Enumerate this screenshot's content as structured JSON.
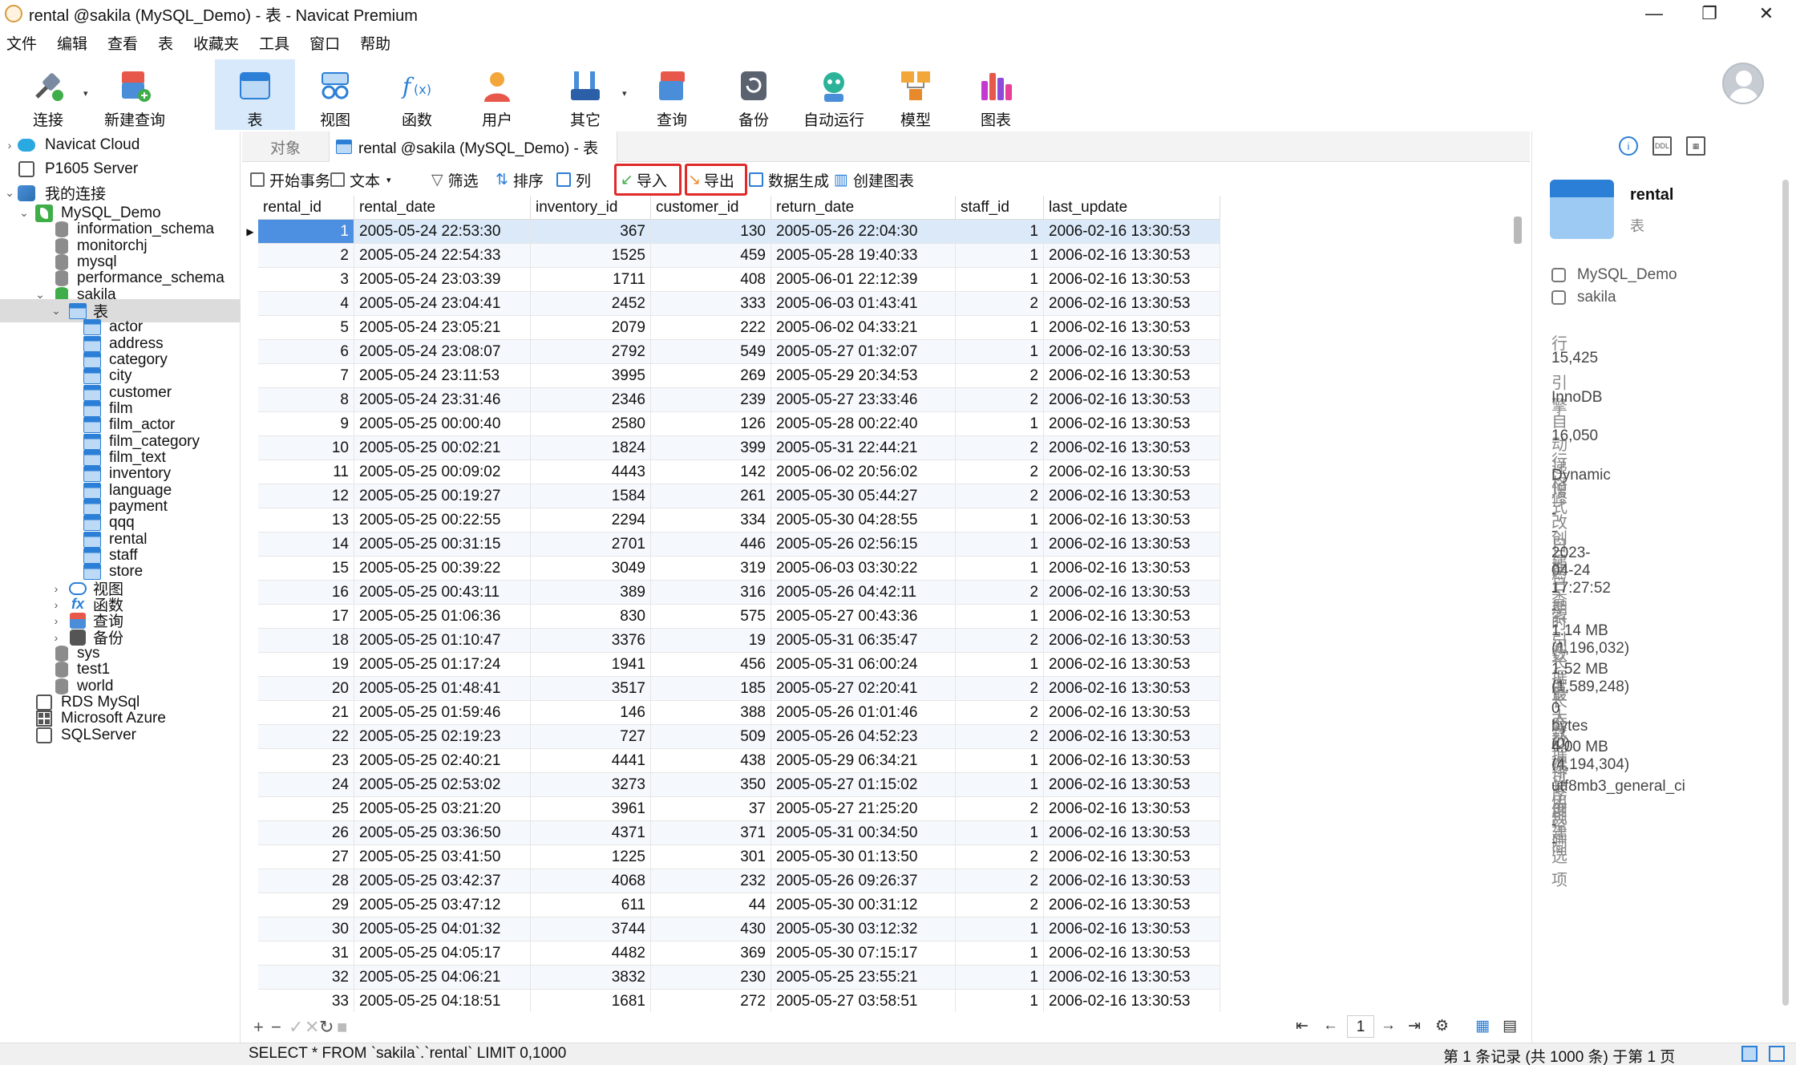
{
  "window": {
    "title": "rental @sakila (MySQL_Demo) - 表 - Navicat Premium"
  },
  "menu": [
    "文件",
    "编辑",
    "查看",
    "表",
    "收藏夹",
    "工具",
    "窗口",
    "帮助"
  ],
  "toolbar": [
    {
      "label": "连接",
      "icon": "plug-connect-icon"
    },
    {
      "label": "新建查询",
      "icon": "new-query-icon"
    },
    {
      "label": "表",
      "icon": "table-icon"
    },
    {
      "label": "视图",
      "icon": "view-glasses-icon"
    },
    {
      "label": "函数",
      "icon": "function-fx-icon"
    },
    {
      "label": "用户",
      "icon": "user-icon"
    },
    {
      "label": "其它",
      "icon": "tools-icon"
    },
    {
      "label": "查询",
      "icon": "query-icon"
    },
    {
      "label": "备份",
      "icon": "backup-icon"
    },
    {
      "label": "自动运行",
      "icon": "robot-icon"
    },
    {
      "label": "模型",
      "icon": "model-icon"
    },
    {
      "label": "图表",
      "icon": "chart-icon"
    }
  ],
  "sidebar": {
    "nodes": [
      {
        "label": "Navicat Cloud",
        "icon": "cloud-icon"
      },
      {
        "label": "P1605 Server",
        "icon": "server-icon"
      },
      {
        "label": "我的连接",
        "icon": "plug-icon"
      },
      {
        "label": "MySQL_Demo",
        "icon": "mysql-connection-icon"
      },
      {
        "label": "information_schema",
        "icon": "database-icon"
      },
      {
        "label": "monitorchj",
        "icon": "database-icon"
      },
      {
        "label": "mysql",
        "icon": "database-icon"
      },
      {
        "label": "performance_schema",
        "icon": "database-icon"
      },
      {
        "label": "sakila",
        "icon": "database-icon"
      },
      {
        "label": "表",
        "icon": "tables-folder-icon"
      },
      {
        "label": "actor",
        "icon": "table-icon"
      },
      {
        "label": "address",
        "icon": "table-icon"
      },
      {
        "label": "category",
        "icon": "table-icon"
      },
      {
        "label": "city",
        "icon": "table-icon"
      },
      {
        "label": "customer",
        "icon": "table-icon"
      },
      {
        "label": "film",
        "icon": "table-icon"
      },
      {
        "label": "film_actor",
        "icon": "table-icon"
      },
      {
        "label": "film_category",
        "icon": "table-icon"
      },
      {
        "label": "film_text",
        "icon": "table-icon"
      },
      {
        "label": "inventory",
        "icon": "table-icon"
      },
      {
        "label": "language",
        "icon": "table-icon"
      },
      {
        "label": "payment",
        "icon": "table-icon"
      },
      {
        "label": "qqq",
        "icon": "table-icon"
      },
      {
        "label": "rental",
        "icon": "table-icon"
      },
      {
        "label": "staff",
        "icon": "table-icon"
      },
      {
        "label": "store",
        "icon": "table-icon"
      },
      {
        "label": "视图",
        "icon": "view-icon"
      },
      {
        "label": "函数",
        "icon": "function-icon"
      },
      {
        "label": "查询",
        "icon": "query-icon"
      },
      {
        "label": "备份",
        "icon": "backup-icon"
      },
      {
        "label": "sys",
        "icon": "database-icon"
      },
      {
        "label": "test1",
        "icon": "database-icon"
      },
      {
        "label": "world",
        "icon": "database-icon"
      },
      {
        "label": "RDS MySql",
        "icon": "rds-icon"
      },
      {
        "label": "Microsoft Azure",
        "icon": "azure-icon"
      },
      {
        "label": "SQLServer",
        "icon": "sqlserver-icon"
      }
    ]
  },
  "tabs": {
    "objects": "对象",
    "active": "rental @sakila (MySQL_Demo) - 表"
  },
  "subtoolbar": {
    "begin_tx": "开始事务",
    "text": "文本",
    "filter": "筛选",
    "sort": "排序",
    "columns": "列",
    "import": "导入",
    "export": "导出",
    "datagen": "数据生成",
    "create_chart": "创建图表"
  },
  "grid": {
    "columns": [
      "rental_id",
      "rental_date",
      "inventory_id",
      "customer_id",
      "return_date",
      "staff_id",
      "last_update"
    ],
    "rows": [
      [
        "1",
        "2005-05-24 22:53:30",
        "367",
        "130",
        "2005-05-26 22:04:30",
        "1",
        "2006-02-16 13:30:53"
      ],
      [
        "2",
        "2005-05-24 22:54:33",
        "1525",
        "459",
        "2005-05-28 19:40:33",
        "1",
        "2006-02-16 13:30:53"
      ],
      [
        "3",
        "2005-05-24 23:03:39",
        "1711",
        "408",
        "2005-06-01 22:12:39",
        "1",
        "2006-02-16 13:30:53"
      ],
      [
        "4",
        "2005-05-24 23:04:41",
        "2452",
        "333",
        "2005-06-03 01:43:41",
        "2",
        "2006-02-16 13:30:53"
      ],
      [
        "5",
        "2005-05-24 23:05:21",
        "2079",
        "222",
        "2005-06-02 04:33:21",
        "1",
        "2006-02-16 13:30:53"
      ],
      [
        "6",
        "2005-05-24 23:08:07",
        "2792",
        "549",
        "2005-05-27 01:32:07",
        "1",
        "2006-02-16 13:30:53"
      ],
      [
        "7",
        "2005-05-24 23:11:53",
        "3995",
        "269",
        "2005-05-29 20:34:53",
        "2",
        "2006-02-16 13:30:53"
      ],
      [
        "8",
        "2005-05-24 23:31:46",
        "2346",
        "239",
        "2005-05-27 23:33:46",
        "2",
        "2006-02-16 13:30:53"
      ],
      [
        "9",
        "2005-05-25 00:00:40",
        "2580",
        "126",
        "2005-05-28 00:22:40",
        "1",
        "2006-02-16 13:30:53"
      ],
      [
        "10",
        "2005-05-25 00:02:21",
        "1824",
        "399",
        "2005-05-31 22:44:21",
        "2",
        "2006-02-16 13:30:53"
      ],
      [
        "11",
        "2005-05-25 00:09:02",
        "4443",
        "142",
        "2005-06-02 20:56:02",
        "2",
        "2006-02-16 13:30:53"
      ],
      [
        "12",
        "2005-05-25 00:19:27",
        "1584",
        "261",
        "2005-05-30 05:44:27",
        "2",
        "2006-02-16 13:30:53"
      ],
      [
        "13",
        "2005-05-25 00:22:55",
        "2294",
        "334",
        "2005-05-30 04:28:55",
        "1",
        "2006-02-16 13:30:53"
      ],
      [
        "14",
        "2005-05-25 00:31:15",
        "2701",
        "446",
        "2005-05-26 02:56:15",
        "1",
        "2006-02-16 13:30:53"
      ],
      [
        "15",
        "2005-05-25 00:39:22",
        "3049",
        "319",
        "2005-06-03 03:30:22",
        "1",
        "2006-02-16 13:30:53"
      ],
      [
        "16",
        "2005-05-25 00:43:11",
        "389",
        "316",
        "2005-05-26 04:42:11",
        "2",
        "2006-02-16 13:30:53"
      ],
      [
        "17",
        "2005-05-25 01:06:36",
        "830",
        "575",
        "2005-05-27 00:43:36",
        "1",
        "2006-02-16 13:30:53"
      ],
      [
        "18",
        "2005-05-25 01:10:47",
        "3376",
        "19",
        "2005-05-31 06:35:47",
        "2",
        "2006-02-16 13:30:53"
      ],
      [
        "19",
        "2005-05-25 01:17:24",
        "1941",
        "456",
        "2005-05-31 06:00:24",
        "1",
        "2006-02-16 13:30:53"
      ],
      [
        "20",
        "2005-05-25 01:48:41",
        "3517",
        "185",
        "2005-05-27 02:20:41",
        "2",
        "2006-02-16 13:30:53"
      ],
      [
        "21",
        "2005-05-25 01:59:46",
        "146",
        "388",
        "2005-05-26 01:01:46",
        "2",
        "2006-02-16 13:30:53"
      ],
      [
        "22",
        "2005-05-25 02:19:23",
        "727",
        "509",
        "2005-05-26 04:52:23",
        "2",
        "2006-02-16 13:30:53"
      ],
      [
        "23",
        "2005-05-25 02:40:21",
        "4441",
        "438",
        "2005-05-29 06:34:21",
        "1",
        "2006-02-16 13:30:53"
      ],
      [
        "24",
        "2005-05-25 02:53:02",
        "3273",
        "350",
        "2005-05-27 01:15:02",
        "1",
        "2006-02-16 13:30:53"
      ],
      [
        "25",
        "2005-05-25 03:21:20",
        "3961",
        "37",
        "2005-05-27 21:25:20",
        "2",
        "2006-02-16 13:30:53"
      ],
      [
        "26",
        "2005-05-25 03:36:50",
        "4371",
        "371",
        "2005-05-31 00:34:50",
        "1",
        "2006-02-16 13:30:53"
      ],
      [
        "27",
        "2005-05-25 03:41:50",
        "1225",
        "301",
        "2005-05-30 01:13:50",
        "2",
        "2006-02-16 13:30:53"
      ],
      [
        "28",
        "2005-05-25 03:42:37",
        "4068",
        "232",
        "2005-05-26 09:26:37",
        "2",
        "2006-02-16 13:30:53"
      ],
      [
        "29",
        "2005-05-25 03:47:12",
        "611",
        "44",
        "2005-05-30 00:31:12",
        "2",
        "2006-02-16 13:30:53"
      ],
      [
        "30",
        "2005-05-25 04:01:32",
        "3744",
        "430",
        "2005-05-30 03:12:32",
        "1",
        "2006-02-16 13:30:53"
      ],
      [
        "31",
        "2005-05-25 04:05:17",
        "4482",
        "369",
        "2005-05-30 07:15:17",
        "1",
        "2006-02-16 13:30:53"
      ],
      [
        "32",
        "2005-05-25 04:06:21",
        "3832",
        "230",
        "2005-05-25 23:55:21",
        "1",
        "2006-02-16 13:30:53"
      ],
      [
        "33",
        "2005-05-25 04:18:51",
        "1681",
        "272",
        "2005-05-27 03:58:51",
        "1",
        "2006-02-16 13:30:53"
      ]
    ]
  },
  "pager": {
    "page": "1"
  },
  "status": {
    "sql": "SELECT * FROM `sakila`.`rental` LIMIT 0,1000",
    "records": "第 1 条记录 (共 1000 条) 于第 1 页"
  },
  "info_panel": {
    "name": "rental",
    "type": "表",
    "connection": "MySQL_Demo",
    "database": "sakila",
    "props": [
      {
        "k": "行",
        "v": "15,425"
      },
      {
        "k": "引擎",
        "v": "InnoDB"
      },
      {
        "k": "自动递增",
        "v": "16,050"
      },
      {
        "k": "行格式",
        "v": "Dynamic"
      },
      {
        "k": "修改日期",
        "v": "--"
      },
      {
        "k": "创建日期",
        "v": "2023-04-24 17:27:52"
      },
      {
        "k": "检查时间",
        "v": "--"
      },
      {
        "k": "索引长度",
        "v": "1.14 MB (1,196,032)"
      },
      {
        "k": "数据长度",
        "v": "1.52 MB (1,589,248)"
      },
      {
        "k": "最大数据长度",
        "v": "0 bytes (0)"
      },
      {
        "k": "数据可用空间",
        "v": "4.00 MB (4,194,304)"
      },
      {
        "k": "排序规则",
        "v": "utf8mb3_general_ci"
      },
      {
        "k": "创建选项",
        "v": "--"
      }
    ]
  },
  "colors": {
    "accent": "#2b7fd6",
    "highlight_box": "#e02a2a",
    "selected_row": "#dbe9f8"
  }
}
